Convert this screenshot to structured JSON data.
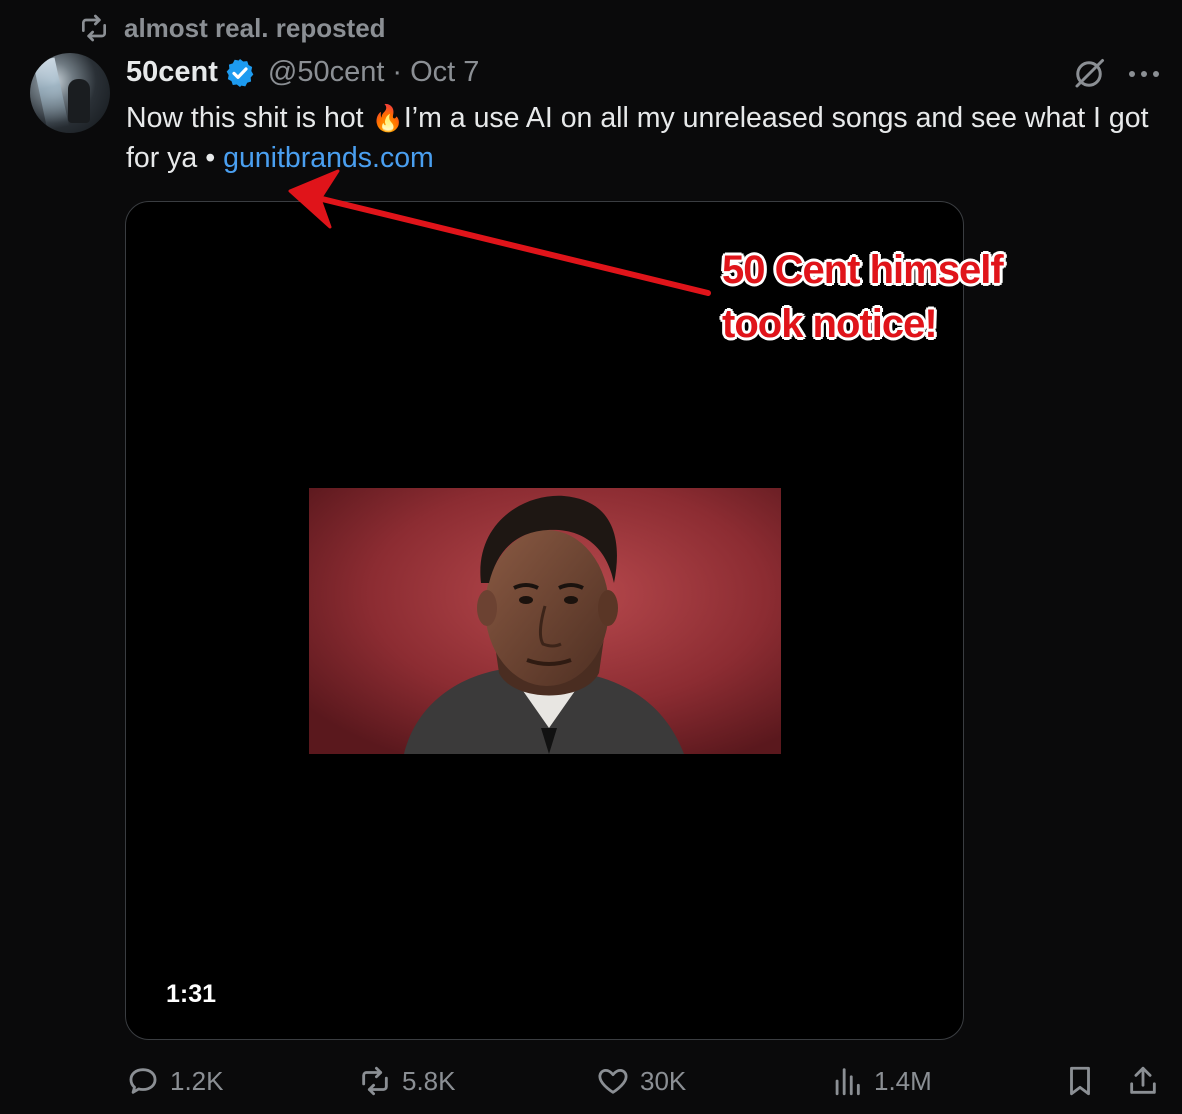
{
  "repost": {
    "icon": "repost-icon",
    "text": "almost real. reposted"
  },
  "post": {
    "author_name": "50cent",
    "verified_icon": "verified-badge-icon",
    "handle": "@50cent",
    "separator": "·",
    "date": "Oct 7",
    "text_part1": "Now this shit is hot ",
    "emoji": "🔥",
    "text_part2": "I’m a use AI on all my unreleased songs and see what I got for ya • ",
    "link": "gunitbrands.com",
    "media": {
      "duration": "1:31"
    }
  },
  "annotation": {
    "line1": "50 Cent himself",
    "line2": "took notice!",
    "color": "#e0141a"
  },
  "actions": {
    "replies": "1.2K",
    "reposts": "5.8K",
    "likes": "30K",
    "views": "1.4M"
  },
  "colors": {
    "background": "#0a0a0b",
    "text": "#e7e9ea",
    "muted": "#8b8f94",
    "link": "#4a9ff0",
    "verified": "#1d9bf0"
  }
}
